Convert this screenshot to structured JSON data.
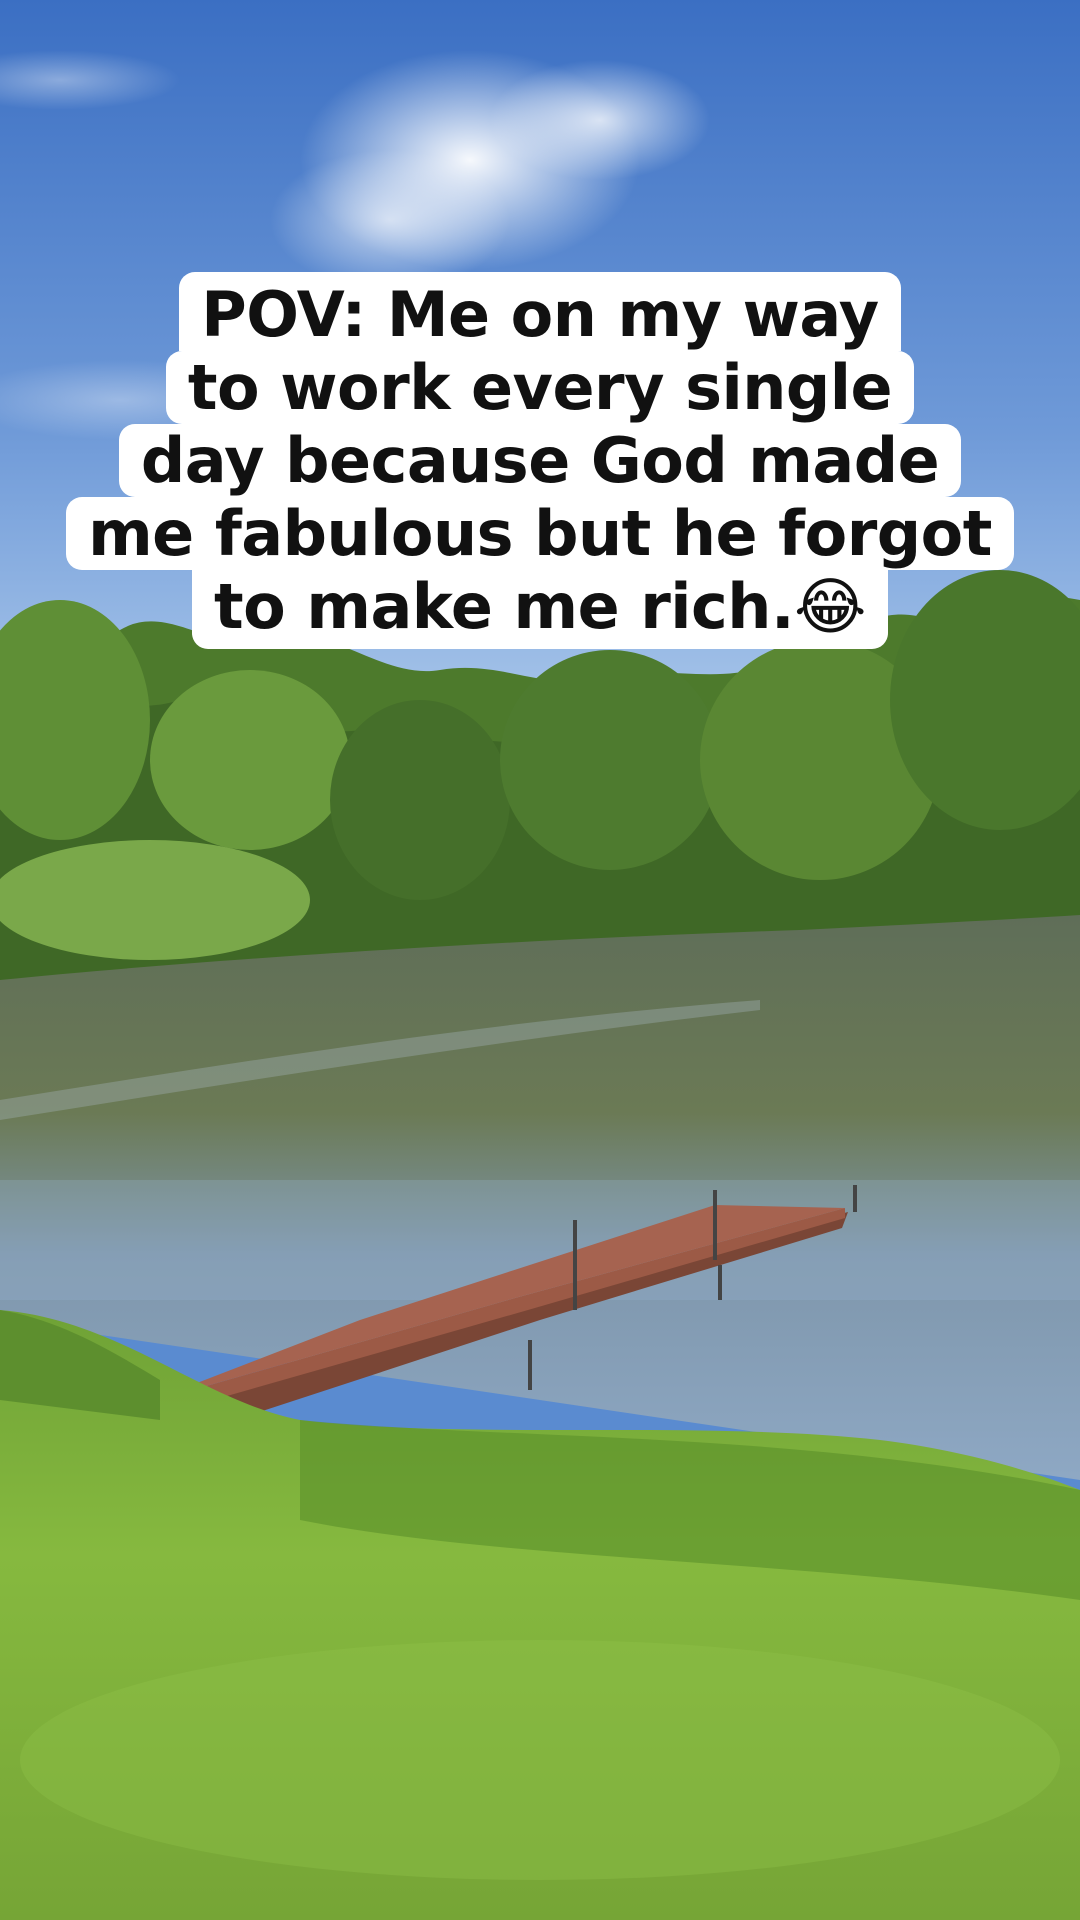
{
  "caption": {
    "lines": [
      "POV: Me on my way",
      "to work every single",
      "day because God made",
      "me fabulous but he forgot",
      "to make me rich.😂"
    ]
  },
  "colors": {
    "sky_top": "#3f73c6",
    "sky_bottom": "#9fc1ea",
    "trees": "#4f7d2e",
    "water": "#5e6b52",
    "dock": "#9c5a46",
    "grass": "#7fb13a",
    "caption_bg": "#ffffff",
    "caption_text": "#111111"
  }
}
